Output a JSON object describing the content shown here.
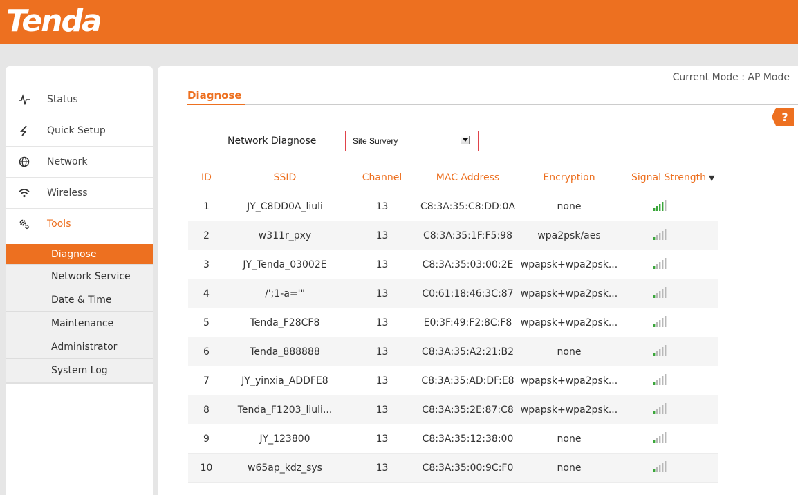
{
  "brand": {
    "logo": "Tenda",
    "accent": "#ed7020"
  },
  "mode_text": "Current Mode : AP Mode",
  "sidebar": {
    "items": [
      {
        "label": "Status",
        "icon": "pulse-icon"
      },
      {
        "label": "Quick Setup",
        "icon": "lightning-icon"
      },
      {
        "label": "Network",
        "icon": "globe-icon"
      },
      {
        "label": "Wireless",
        "icon": "wifi-icon"
      },
      {
        "label": "Tools",
        "icon": "gears-icon",
        "active": true
      }
    ],
    "sub_items": [
      {
        "label": "Diagnose",
        "active": true
      },
      {
        "label": "Network Service"
      },
      {
        "label": "Date & Time"
      },
      {
        "label": "Maintenance"
      },
      {
        "label": "Administrator"
      },
      {
        "label": "System Log"
      }
    ]
  },
  "page": {
    "title": "Diagnose",
    "help_label": "?",
    "diag_label": "Network Diagnose",
    "diag_value": "Site Survery"
  },
  "table": {
    "headers": [
      "ID",
      "SSID",
      "Channel",
      "MAC Address",
      "Encryption",
      "Signal Strength"
    ],
    "sort_indicator": "▼",
    "rows": [
      {
        "id": "1",
        "ssid": "JY_C8DD0A_liuli",
        "channel": "13",
        "mac": "C8:3A:35:C8:DD:0A",
        "enc": "none",
        "signal": 0.8
      },
      {
        "id": "2",
        "ssid": "w311r_pxy",
        "channel": "13",
        "mac": "C8:3A:35:1F:F5:98",
        "enc": "wpa2psk/aes",
        "signal": 0.2
      },
      {
        "id": "3",
        "ssid": "JY_Tenda_03002E",
        "channel": "13",
        "mac": "C8:3A:35:03:00:2E",
        "enc": "wpapsk+wpa2psk...",
        "signal": 0.2
      },
      {
        "id": "4",
        "ssid": "/';1-a='\"",
        "channel": "13",
        "mac": "C0:61:18:46:3C:87",
        "enc": "wpapsk+wpa2psk...",
        "signal": 0.2
      },
      {
        "id": "5",
        "ssid": "Tenda_F28CF8",
        "channel": "13",
        "mac": "E0:3F:49:F2:8C:F8",
        "enc": "wpapsk+wpa2psk...",
        "signal": 0.2
      },
      {
        "id": "6",
        "ssid": "Tenda_888888",
        "channel": "13",
        "mac": "C8:3A:35:A2:21:B2",
        "enc": "none",
        "signal": 0.2
      },
      {
        "id": "7",
        "ssid": "JY_yinxia_ADDFE8",
        "channel": "13",
        "mac": "C8:3A:35:AD:DF:E8",
        "enc": "wpapsk+wpa2psk...",
        "signal": 0.2
      },
      {
        "id": "8",
        "ssid": "Tenda_F1203_liuli...",
        "channel": "13",
        "mac": "C8:3A:35:2E:87:C8",
        "enc": "wpapsk+wpa2psk...",
        "signal": 0.2
      },
      {
        "id": "9",
        "ssid": "JY_123800",
        "channel": "13",
        "mac": "C8:3A:35:12:38:00",
        "enc": "none",
        "signal": 0.2
      },
      {
        "id": "10",
        "ssid": "w65ap_kdz_sys",
        "channel": "13",
        "mac": "C8:3A:35:00:9C:F0",
        "enc": "none",
        "signal": 0.2
      }
    ]
  }
}
